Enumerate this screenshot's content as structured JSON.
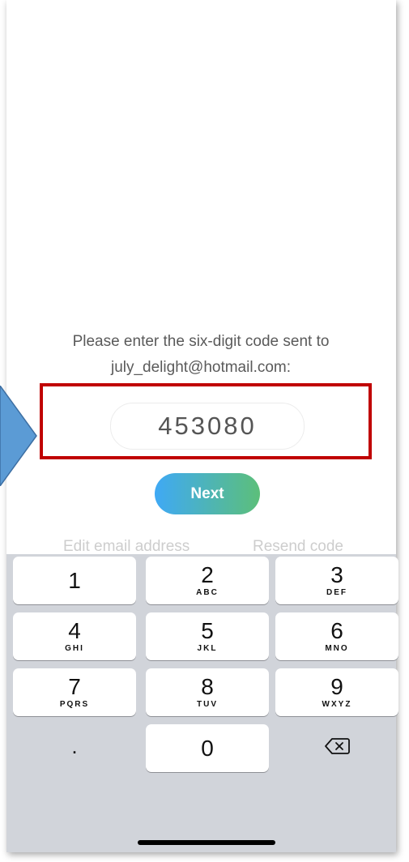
{
  "prompt": {
    "line1": "Please enter the six-digit code sent to",
    "line2": "july_delight@hotmail.com:"
  },
  "code_input": {
    "value": "453080"
  },
  "next_button": {
    "label": "Next"
  },
  "links": {
    "edit_email": "Edit email address",
    "resend": "Resend code"
  },
  "keypad": {
    "keys": [
      {
        "num": "1",
        "letters": ""
      },
      {
        "num": "2",
        "letters": "ABC"
      },
      {
        "num": "3",
        "letters": "DEF"
      },
      {
        "num": "4",
        "letters": "GHI"
      },
      {
        "num": "5",
        "letters": "JKL"
      },
      {
        "num": "6",
        "letters": "MNO"
      },
      {
        "num": "7",
        "letters": "PQRS"
      },
      {
        "num": "8",
        "letters": "TUV"
      },
      {
        "num": "9",
        "letters": "WXYZ"
      },
      {
        "num": "0",
        "letters": ""
      }
    ],
    "dot": ".",
    "delete_icon": "backspace-icon"
  },
  "colors": {
    "highlight_box": "#c00000",
    "arrow": "#5b9bd5",
    "next_gradient_start": "#3fa9f5",
    "next_gradient_end": "#5cbf7a",
    "keyboard_bg": "#d1d4da"
  }
}
